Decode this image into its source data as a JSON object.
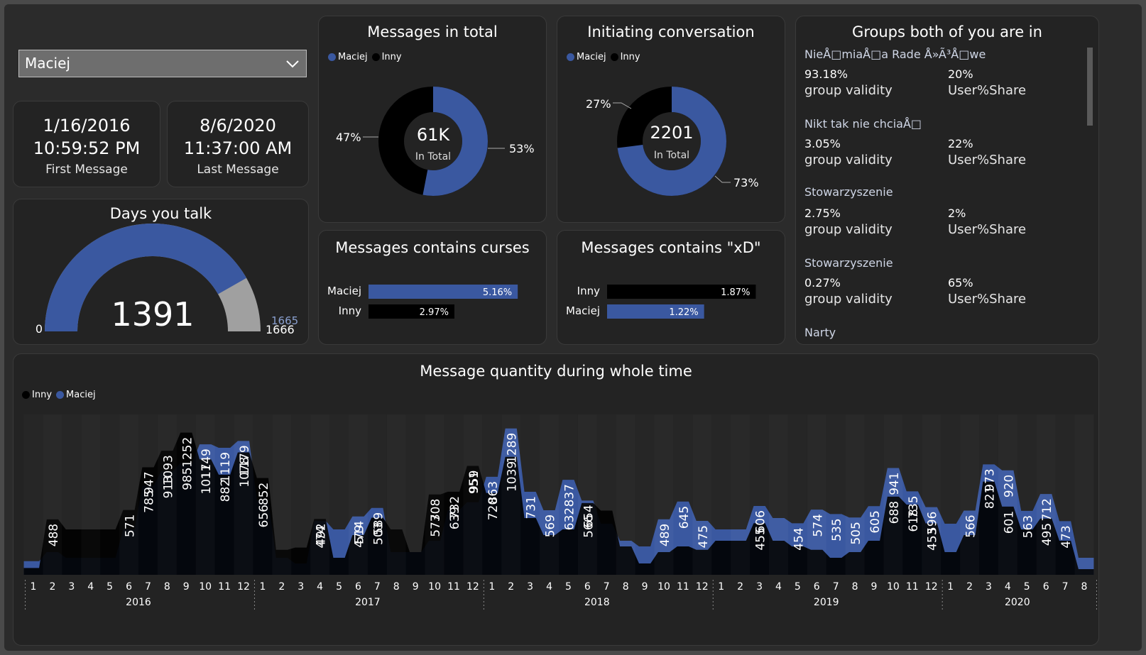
{
  "filter": {
    "selected": "Maciej"
  },
  "first_message": {
    "date": "1/16/2016",
    "time": "10:59:52 PM",
    "label": "First Message"
  },
  "last_message": {
    "date": "8/6/2020",
    "time": "11:37:00 AM",
    "label": "Last Message"
  },
  "days_talk": {
    "title": "Days you talk",
    "value": "1391",
    "min": "0",
    "max": "1666",
    "target": "1665",
    "fraction": 0.835
  },
  "messages_total": {
    "title": "Messages in total",
    "legend": [
      "Maciej",
      "Inny"
    ],
    "center_value": "61K",
    "center_label": "In Total",
    "pct_maciej": "53%",
    "pct_inny": "47%",
    "fraction_maciej": 0.53
  },
  "initiating": {
    "title": "Initiating conversation",
    "legend": [
      "Maciej",
      "Inny"
    ],
    "center_value": "2201",
    "center_label": "In Total",
    "pct_maciej": "73%",
    "pct_inny": "27%",
    "fraction_maciej": 0.73
  },
  "curses": {
    "title": "Messages contains curses",
    "rows": [
      {
        "name": "Maciej",
        "label": "5.16%",
        "value": 5.16,
        "color": "#3a58a0"
      },
      {
        "name": "Inny",
        "label": "2.97%",
        "value": 2.97,
        "color": "#000000"
      }
    ]
  },
  "xd": {
    "title": "Messages contains \"xD\"",
    "rows": [
      {
        "name": "Inny",
        "label": "1.87%",
        "value": 1.87,
        "color": "#000000"
      },
      {
        "name": "Maciej",
        "label": "1.22%",
        "value": 1.22,
        "color": "#3a58a0"
      }
    ]
  },
  "groups": {
    "title": "Groups both of you are in",
    "validity_label": "group validity",
    "share_label": "User%Share",
    "items": [
      {
        "name": "NieÅ□miaÅ□a Rade Å»Ã³Å□we",
        "validity": "93.18%",
        "share": "20%"
      },
      {
        "name": "Nikt tak nie chciaÅ□",
        "validity": "3.05%",
        "share": "22%"
      },
      {
        "name": "Stowarzyszenie",
        "validity": "2.75%",
        "share": "2%"
      },
      {
        "name": "Stowarzyszenie",
        "validity": "0.27%",
        "share": "65%"
      },
      {
        "name": "Narty"
      }
    ]
  },
  "colors": {
    "maciej": "#3a58a0",
    "inny": "#000000",
    "gauge_rest": "#a0a0a0"
  },
  "chart_data": {
    "type": "area",
    "title": "Message quantity during whole time",
    "legend": [
      "Inny",
      "Maciej"
    ],
    "years": [
      "2016",
      "2017",
      "2018",
      "2019",
      "2020"
    ],
    "months": [
      "1",
      "2",
      "3",
      "4",
      "5",
      "6",
      "7",
      "8",
      "9",
      "10",
      "11",
      "12",
      "1",
      "2",
      "3",
      "4",
      "5",
      "6",
      "7",
      "8",
      "9",
      "10",
      "11",
      "12",
      "1",
      "2",
      "3",
      "4",
      "5",
      "6",
      "7",
      "8",
      "9",
      "10",
      "11",
      "12",
      "1",
      "2",
      "3",
      "4",
      "5",
      "6",
      "7",
      "8",
      "9",
      "10",
      "11",
      "12",
      "1",
      "2",
      "3",
      "4",
      "5",
      "6",
      "7",
      "8"
    ],
    "series": [
      {
        "name": "Inny",
        "values": [
          60,
          488,
          400,
          400,
          400,
          571,
          947,
          1093,
          1252,
          1017,
          882,
          1078,
          852,
          220,
          240,
          492,
          150,
          350,
          503,
          400,
          200,
          708,
          732,
          959,
          720,
          1039,
          500,
          350,
          400,
          632,
          566,
          250,
          100,
          200,
          250,
          220,
          300,
          300,
          455,
          300,
          250,
          220,
          150,
          200,
          300,
          688,
          618,
          453,
          200,
          350,
          821,
          601,
          400,
          495,
          300,
          50
        ]
      },
      {
        "name": "Maciej",
        "values": [
          120,
          200,
          150,
          150,
          150,
          400,
          785,
          913,
          985,
          1149,
          1119,
          1179,
          656,
          150,
          100,
          474,
          400,
          514,
          589,
          200,
          200,
          300,
          573,
          639,
          863,
          1289,
          731,
          569,
          837,
          654,
          450,
          300,
          250,
          489,
          645,
          475,
          400,
          400,
          606,
          500,
          454,
          574,
          535,
          505,
          605,
          941,
          735,
          596,
          450,
          566,
          973,
          920,
          563,
          712,
          473,
          150
        ]
      }
    ],
    "labels": [
      {
        "i": 1,
        "text": "488"
      },
      {
        "i": 5,
        "text": "571"
      },
      {
        "i": 6,
        "text": "947"
      },
      {
        "i": 7,
        "text": "1093"
      },
      {
        "i": 8,
        "text": "1252"
      },
      {
        "i": 6,
        "text": "785"
      },
      {
        "i": 7,
        "text": "913"
      },
      {
        "i": 8,
        "text": "985"
      },
      {
        "i": 9,
        "text": "1149"
      },
      {
        "i": 10,
        "text": "1119"
      },
      {
        "i": 11,
        "text": "1179"
      },
      {
        "i": 9,
        "text": "1017"
      },
      {
        "i": 10,
        "text": "882"
      },
      {
        "i": 11,
        "text": "1078"
      },
      {
        "i": 12,
        "text": "852"
      },
      {
        "i": 12,
        "text": "656"
      },
      {
        "i": 15,
        "text": "492"
      },
      {
        "i": 15,
        "text": "474"
      },
      {
        "i": 17,
        "text": "514"
      },
      {
        "i": 17,
        "text": "479"
      },
      {
        "i": 18,
        "text": "589"
      },
      {
        "i": 18,
        "text": "503"
      },
      {
        "i": 21,
        "text": "708"
      },
      {
        "i": 21,
        "text": "573"
      },
      {
        "i": 22,
        "text": "732"
      },
      {
        "i": 22,
        "text": "639"
      },
      {
        "i": 23,
        "text": "959"
      },
      {
        "i": 23,
        "text": "951"
      },
      {
        "i": 24,
        "text": "863"
      },
      {
        "i": 24,
        "text": "720"
      },
      {
        "i": 25,
        "text": "1289"
      },
      {
        "i": 25,
        "text": "1039"
      },
      {
        "i": 26,
        "text": "731"
      },
      {
        "i": 27,
        "text": "569"
      },
      {
        "i": 28,
        "text": "837"
      },
      {
        "i": 28,
        "text": "632"
      },
      {
        "i": 29,
        "text": "654"
      },
      {
        "i": 29,
        "text": "566"
      },
      {
        "i": 33,
        "text": "489"
      },
      {
        "i": 34,
        "text": "645"
      },
      {
        "i": 35,
        "text": "475"
      },
      {
        "i": 38,
        "text": "606"
      },
      {
        "i": 38,
        "text": "455"
      },
      {
        "i": 40,
        "text": "454"
      },
      {
        "i": 41,
        "text": "574"
      },
      {
        "i": 42,
        "text": "535"
      },
      {
        "i": 43,
        "text": "505"
      },
      {
        "i": 44,
        "text": "605"
      },
      {
        "i": 45,
        "text": "941"
      },
      {
        "i": 45,
        "text": "688"
      },
      {
        "i": 46,
        "text": "735"
      },
      {
        "i": 46,
        "text": "618"
      },
      {
        "i": 47,
        "text": "596"
      },
      {
        "i": 47,
        "text": "453"
      },
      {
        "i": 49,
        "text": "566"
      },
      {
        "i": 50,
        "text": "973"
      },
      {
        "i": 50,
        "text": "821"
      },
      {
        "i": 51,
        "text": "920"
      },
      {
        "i": 51,
        "text": "601"
      },
      {
        "i": 52,
        "text": "563"
      },
      {
        "i": 53,
        "text": "712"
      },
      {
        "i": 53,
        "text": "495"
      },
      {
        "i": 54,
        "text": "473"
      }
    ],
    "ylim": [
      0,
      1350
    ]
  }
}
